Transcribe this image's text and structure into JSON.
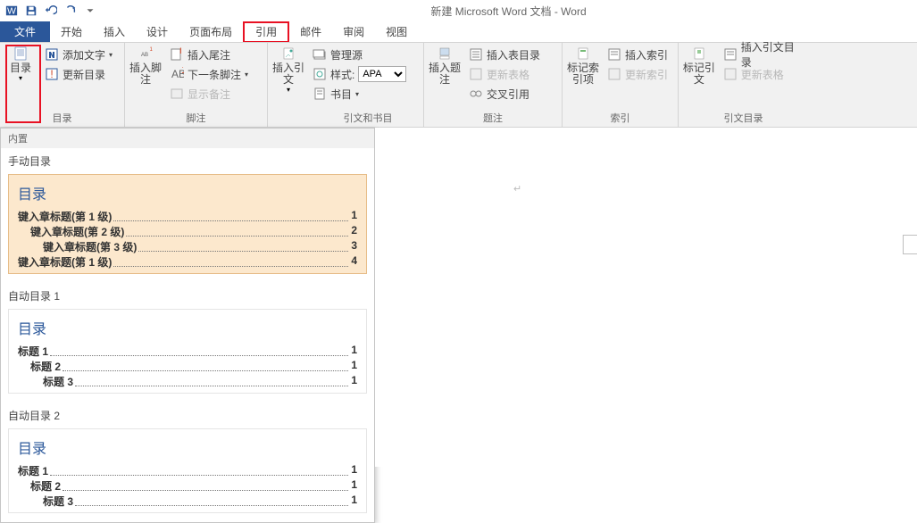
{
  "app": {
    "title": "新建 Microsoft Word 文档 - Word"
  },
  "tabs": {
    "file": "文件",
    "home": "开始",
    "insert": "插入",
    "design": "设计",
    "layout": "页面布局",
    "references": "引用",
    "mail": "邮件",
    "review": "审阅",
    "view": "视图"
  },
  "ribbon": {
    "toc": {
      "label": "目录",
      "add_text": "添加文字",
      "update": "更新目录",
      "group": "目录"
    },
    "footnote": {
      "insert_footnote": "插入脚注",
      "insert_endnote": "插入尾注",
      "next_footnote": "下一条脚注",
      "show_notes": "显示备注",
      "group": "脚注"
    },
    "citation": {
      "insert_citation": "插入引文",
      "manage_sources": "管理源",
      "style_label": "样式:",
      "style_value": "APA",
      "bibliography": "书目",
      "group": "引文和书目"
    },
    "caption": {
      "insert_caption": "插入题注",
      "insert_tof": "插入表目录",
      "update_table": "更新表格",
      "cross_ref": "交叉引用",
      "group": "题注"
    },
    "index": {
      "mark_entry": "标记索引项",
      "insert_index": "插入索引",
      "update_index": "更新索引",
      "group": "索引"
    },
    "toa": {
      "mark_citation": "标记引文",
      "insert_toa": "插入引文目录",
      "update_toa": "更新表格",
      "group": "引文目录"
    }
  },
  "gallery": {
    "header": "内置",
    "manual": {
      "title": "手动目录",
      "heading": "目录",
      "rows": [
        {
          "text": "键入章标题(第 1 级)",
          "page": "1",
          "indent": 0
        },
        {
          "text": "键入章标题(第 2 级)",
          "page": "2",
          "indent": 1
        },
        {
          "text": "键入章标题(第 3 级)",
          "page": "3",
          "indent": 2
        },
        {
          "text": "键入章标题(第 1 级)",
          "page": "4",
          "indent": 0
        }
      ]
    },
    "auto1": {
      "title": "自动目录 1",
      "heading": "目录",
      "rows": [
        {
          "text": "标题 1",
          "page": "1",
          "indent": 0
        },
        {
          "text": "标题 2",
          "page": "1",
          "indent": 1
        },
        {
          "text": "标题 3",
          "page": "1",
          "indent": 2
        }
      ]
    },
    "auto2": {
      "title": "自动目录 2",
      "heading": "目录",
      "rows": [
        {
          "text": "标题 1",
          "page": "1",
          "indent": 0
        },
        {
          "text": "标题 2",
          "page": "1",
          "indent": 1
        },
        {
          "text": "标题 3",
          "page": "1",
          "indent": 2
        }
      ]
    }
  },
  "doc": {
    "cursor": "↵"
  }
}
